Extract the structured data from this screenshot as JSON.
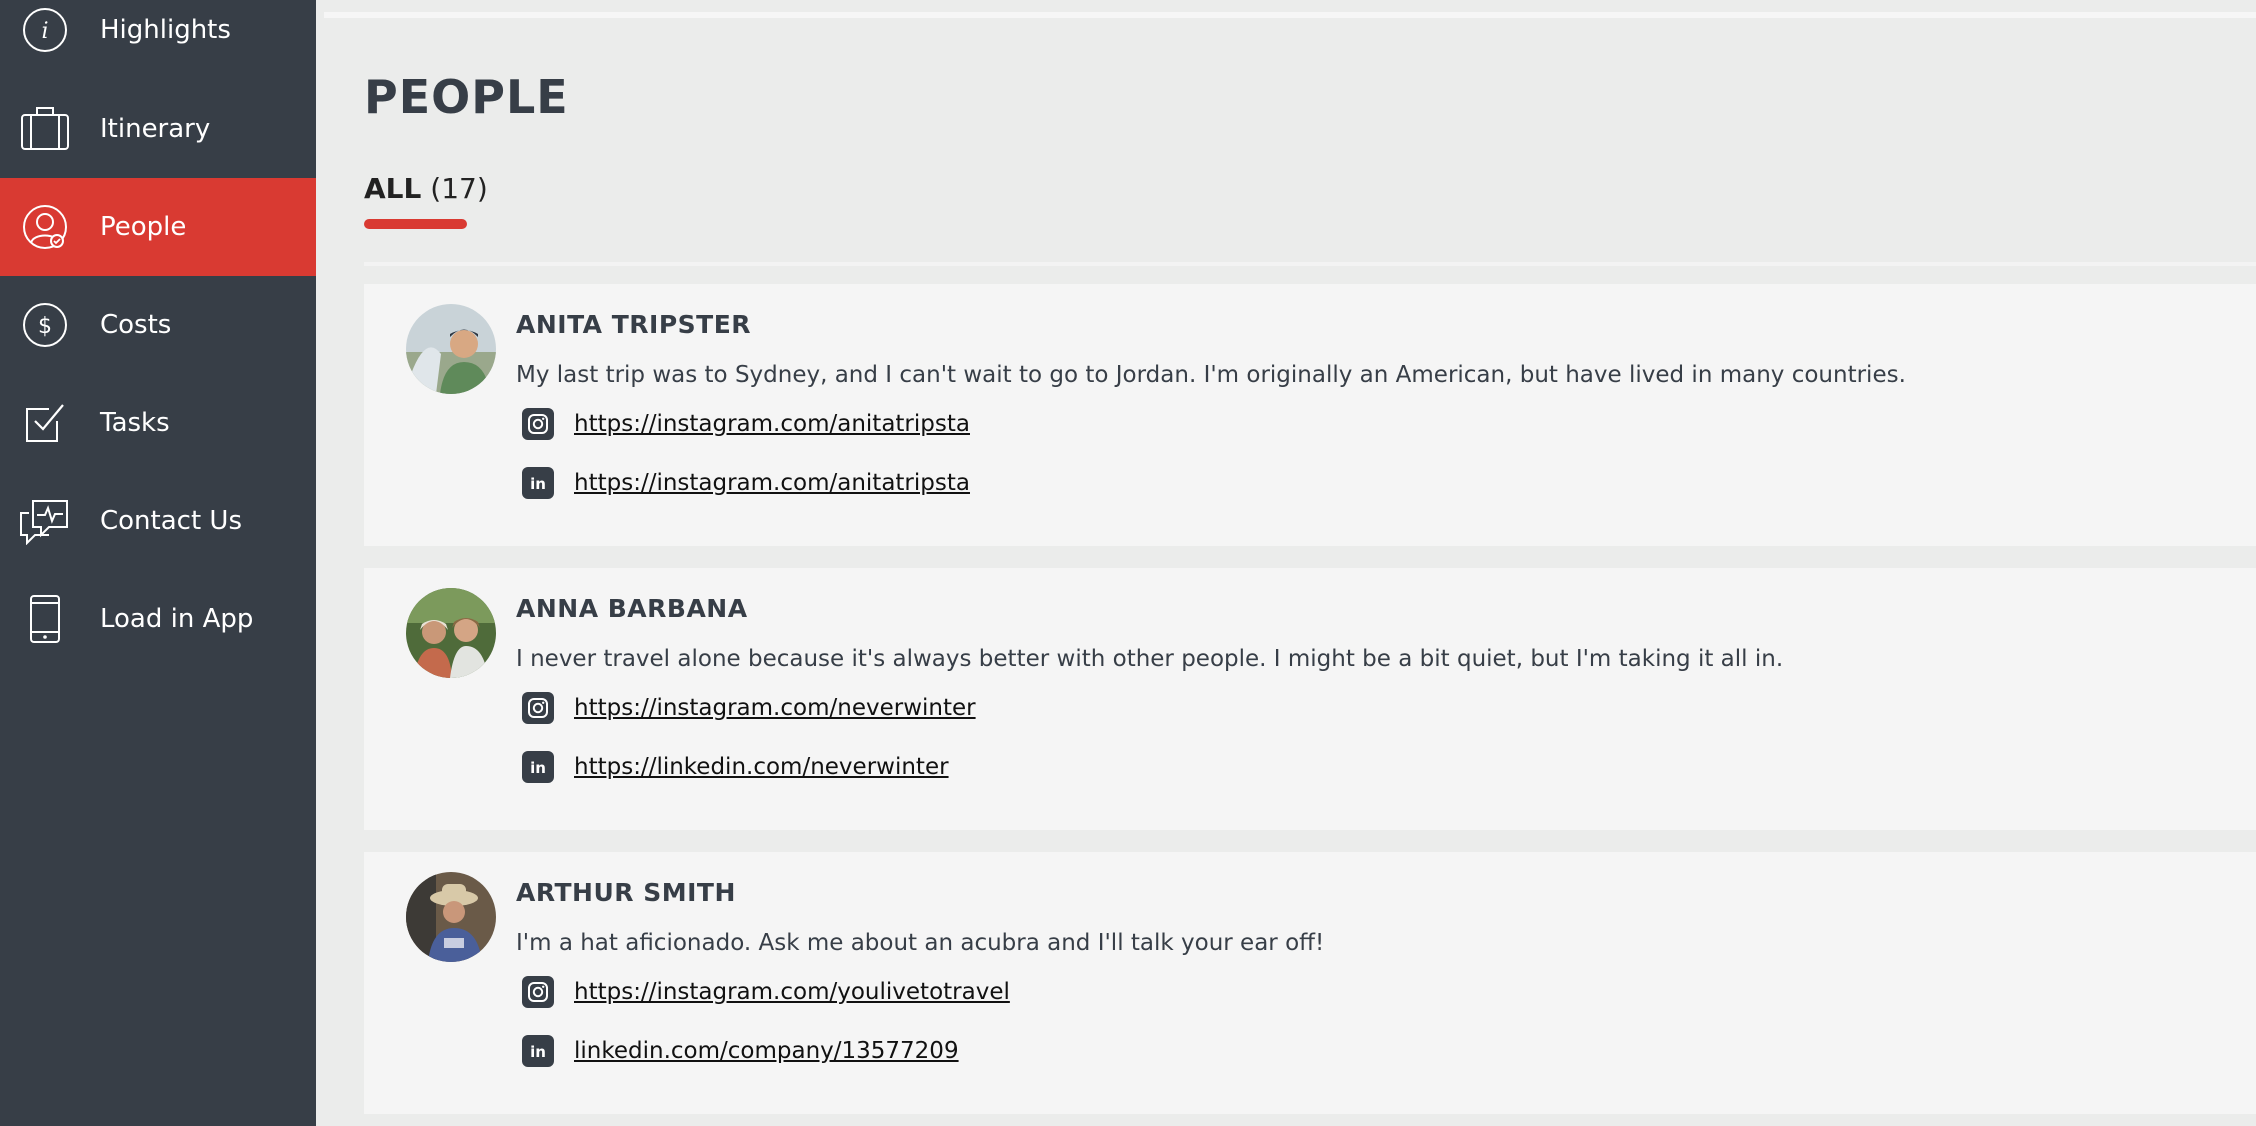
{
  "colors": {
    "sidebar_bg": "#373e47",
    "accent": "#d93a32",
    "page_bg": "#ebeceb",
    "card_bg": "#f5f5f5"
  },
  "sidebar": {
    "items": [
      {
        "label": "Highlights",
        "icon": "info-icon",
        "active": false
      },
      {
        "label": "Itinerary",
        "icon": "suitcase-icon",
        "active": false
      },
      {
        "label": "People",
        "icon": "person-check-icon",
        "active": true
      },
      {
        "label": "Costs",
        "icon": "dollar-icon",
        "active": false
      },
      {
        "label": "Tasks",
        "icon": "checkbox-icon",
        "active": false
      },
      {
        "label": "Contact Us",
        "icon": "chat-icon",
        "active": false
      },
      {
        "label": "Load in App",
        "icon": "phone-icon",
        "active": false
      }
    ]
  },
  "main": {
    "title": "PEOPLE",
    "tab": {
      "label": "ALL",
      "count": "(17)"
    },
    "people": [
      {
        "name": "ANITA TRIPSTER",
        "bio": "My last trip was to Sydney, and I can't wait to go to Jordan. I'm originally an American, but have lived in many countries.",
        "instagram": "https://instagram.com/anitatripsta",
        "linkedin": "https://instagram.com/anitatripsta"
      },
      {
        "name": "ANNA BARBANA",
        "bio": "I never travel alone because it's always better with other people. I might be a bit quiet, but I'm taking it all in.",
        "instagram": "https://instagram.com/neverwinter",
        "linkedin": "https://linkedin.com/neverwinter"
      },
      {
        "name": "ARTHUR SMITH",
        "bio": "I'm a hat aficionado. Ask me about an acubra and I'll talk your ear off!",
        "instagram": "https://instagram.com/youlivetotravel",
        "linkedin": "linkedin.com/company/13577209"
      }
    ]
  }
}
